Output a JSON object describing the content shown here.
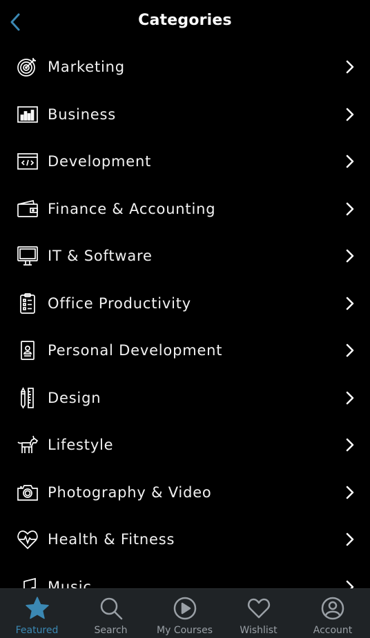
{
  "header": {
    "title": "Categories",
    "back_icon": "chevron-left-icon"
  },
  "colors": {
    "accent": "#3b88b3",
    "background": "#000000",
    "tabbar": "#1f2326",
    "inactive": "#9aa0a6"
  },
  "categories": [
    {
      "label": "Marketing",
      "icon": "target-icon"
    },
    {
      "label": "Business",
      "icon": "bar-chart-icon"
    },
    {
      "label": "Development",
      "icon": "code-window-icon"
    },
    {
      "label": "Finance & Accounting",
      "icon": "wallet-icon"
    },
    {
      "label": "IT & Software",
      "icon": "monitor-icon"
    },
    {
      "label": "Office Productivity",
      "icon": "clipboard-list-icon"
    },
    {
      "label": "Personal Development",
      "icon": "id-badge-icon"
    },
    {
      "label": "Design",
      "icon": "pencil-ruler-icon"
    },
    {
      "label": "Lifestyle",
      "icon": "dog-icon"
    },
    {
      "label": "Photography & Video",
      "icon": "camera-icon"
    },
    {
      "label": "Health & Fitness",
      "icon": "heartbeat-icon"
    },
    {
      "label": "Music",
      "icon": "music-note-icon"
    }
  ],
  "tabs": [
    {
      "label": "Featured",
      "icon": "star-icon",
      "active": true
    },
    {
      "label": "Search",
      "icon": "search-icon",
      "active": false
    },
    {
      "label": "My Courses",
      "icon": "play-circle-icon",
      "active": false
    },
    {
      "label": "Wishlist",
      "icon": "heart-icon",
      "active": false
    },
    {
      "label": "Account",
      "icon": "user-circle-icon",
      "active": false
    }
  ]
}
